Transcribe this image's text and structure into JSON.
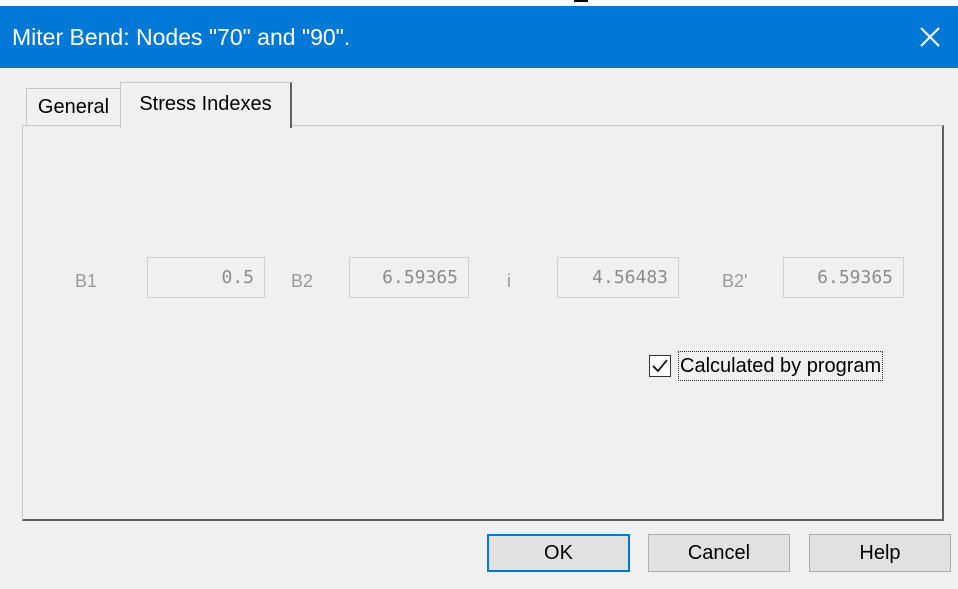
{
  "window": {
    "title": "Miter Bend: Nodes  \"70\" and \"90\".",
    "close_icon": "close-icon"
  },
  "tabs": [
    {
      "label": "General",
      "active": false
    },
    {
      "label": "Stress Indexes",
      "active": true
    }
  ],
  "stress_indexes": {
    "b1": {
      "label": "B1",
      "value": "0.5"
    },
    "b2": {
      "label": "B2",
      "value": "6.59365"
    },
    "i": {
      "label": "i",
      "value": "4.56483"
    },
    "b2_prime": {
      "label": "B2'",
      "value": "6.59365"
    },
    "calculated_by_program": {
      "label": "Calculated by program",
      "checked": true
    }
  },
  "buttons": {
    "ok": "OK",
    "cancel": "Cancel",
    "help": "Help"
  },
  "colors": {
    "titlebar": "#0078d7",
    "dialog_bg": "#f0f0f0",
    "disabled_text": "#9a9a9a"
  }
}
